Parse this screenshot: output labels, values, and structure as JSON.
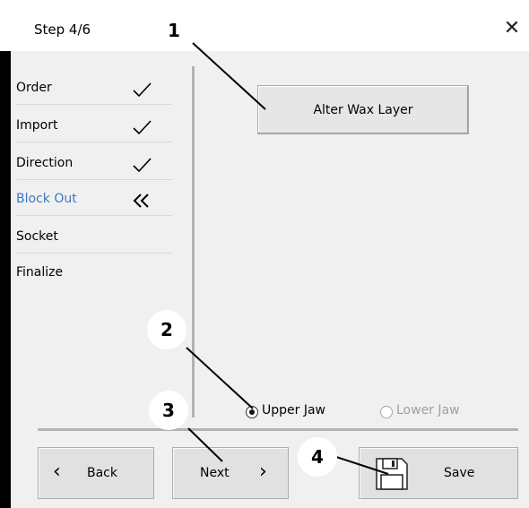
{
  "window": {
    "title": "Step 4/6",
    "close_glyph": "✕"
  },
  "steps": [
    {
      "label": "Order",
      "mark": "check-icon"
    },
    {
      "label": "Import",
      "mark": "check-icon"
    },
    {
      "label": "Direction",
      "mark": "check-icon"
    },
    {
      "label": "Block Out",
      "mark": "double-chevron-left-icon",
      "active": true
    },
    {
      "label": "Socket",
      "mark": ""
    },
    {
      "label": "Finalize",
      "mark": ""
    }
  ],
  "main": {
    "alter_wax_button": "Alter Wax Layer",
    "jaw_options": [
      {
        "label": "Upper Jaw",
        "selected": true,
        "enabled": true
      },
      {
        "label": "Lower Jaw",
        "selected": false,
        "enabled": false
      }
    ]
  },
  "footer": {
    "back_label": "Back",
    "next_label": "Next",
    "save_label": "Save"
  },
  "callouts": [
    "1",
    "2",
    "3",
    "4"
  ],
  "colors": {
    "active_step": "#3a78c2",
    "left_bar": "#000000",
    "panel": "#f0f0f0"
  }
}
